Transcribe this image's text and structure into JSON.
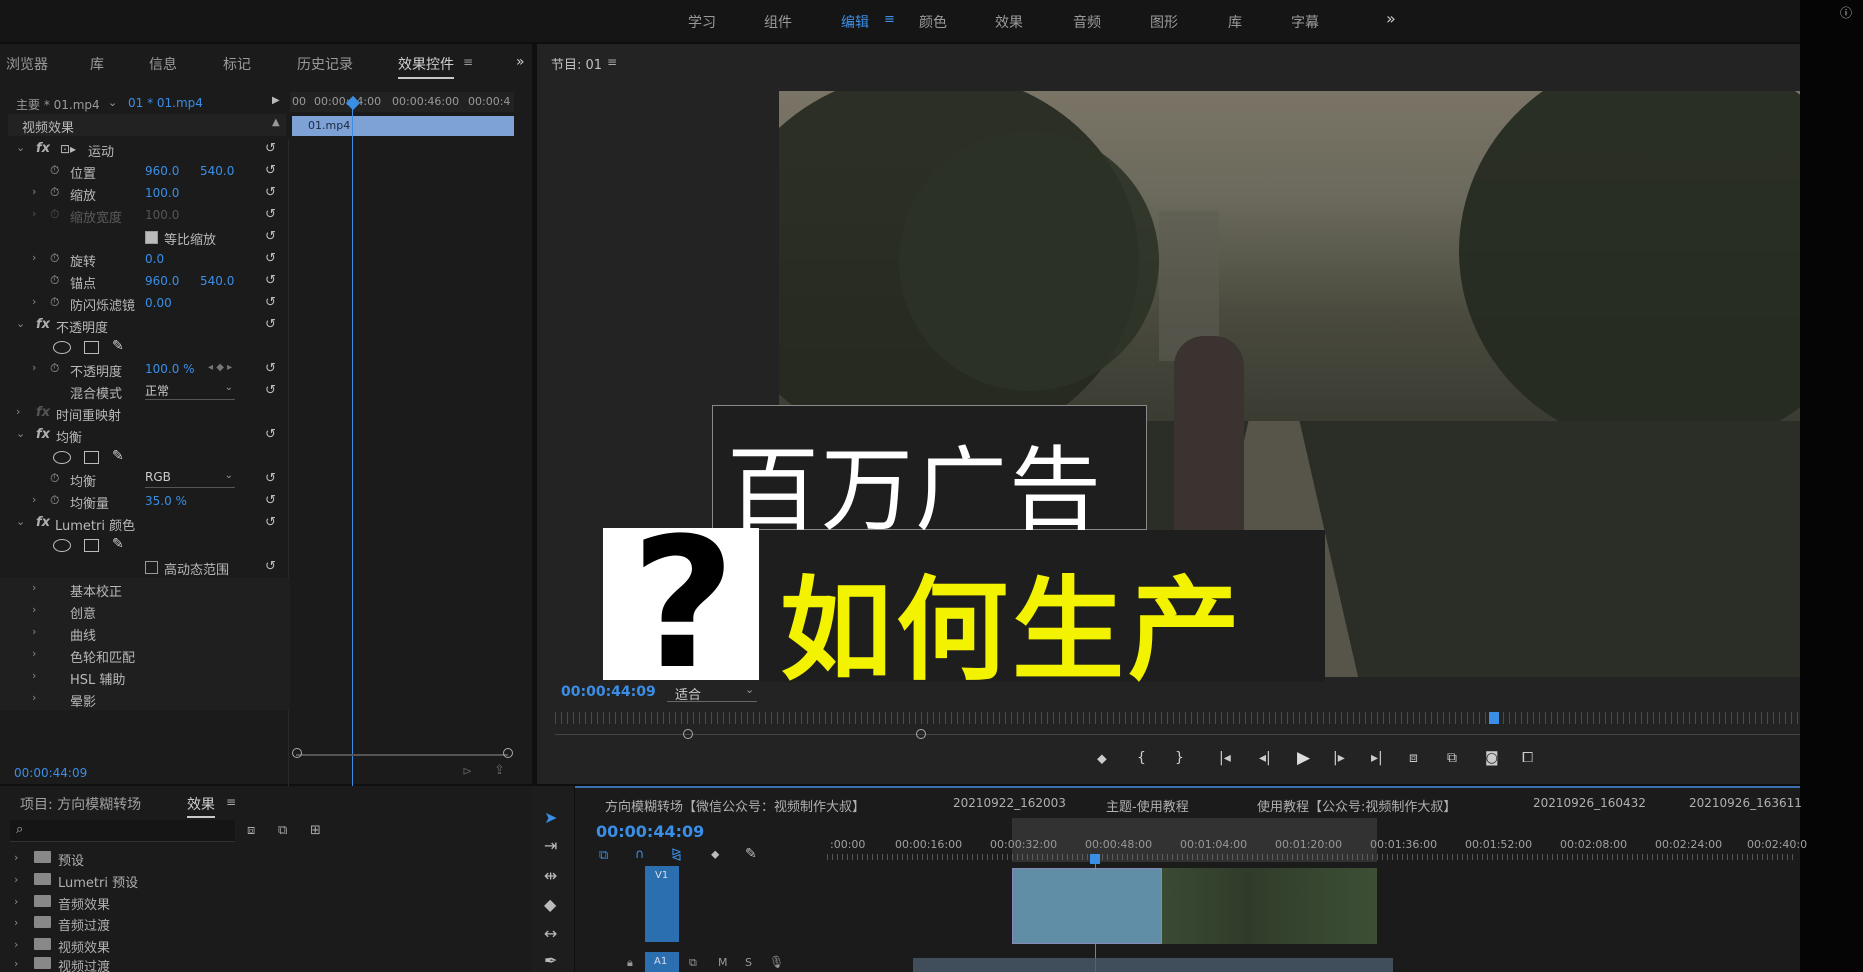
{
  "workspaces": [
    "学习",
    "组件",
    "编辑",
    "颜色",
    "效果",
    "音频",
    "图形",
    "库",
    "字幕"
  ],
  "workspace_active": "编辑",
  "workspace_more": "»",
  "left_tabs": [
    "浏览器",
    "库",
    "信息",
    "标记",
    "历史记录",
    "效果控件"
  ],
  "left_tabs_more": "»",
  "program_title": "节目: 01",
  "ec": {
    "master": "主要 * 01.mp4",
    "clip": "01 * 01.mp4",
    "ruler": [
      "00",
      "00:00:44:00",
      "00:00:46:00",
      "00:00:4"
    ],
    "clip_bar": "01.mp4",
    "section_video": "视频效果",
    "time": "00:00:44:09",
    "rows": {
      "motion": "运动",
      "position": "位置",
      "position_x": "960.0",
      "position_y": "540.0",
      "scale": "缩放",
      "scale_v": "100.0",
      "scale_w": "缩放宽度",
      "scale_w_v": "100.0",
      "uniform": "等比缩放",
      "rotation": "旋转",
      "rotation_v": "0.0",
      "anchor": "锚点",
      "anchor_x": "960.0",
      "anchor_y": "540.0",
      "flicker": "防闪烁滤镜",
      "flicker_v": "0.00",
      "opacity_group": "不透明度",
      "opacity": "不透明度",
      "opacity_v": "100.0 %",
      "blend": "混合模式",
      "blend_v": "正常",
      "timeremap": "时间重映射",
      "equalize_group": "均衡",
      "equalize": "均衡",
      "equalize_v": "RGB",
      "equalize_amt": "均衡量",
      "equalize_amt_v": "35.0 %",
      "lumetri": "Lumetri 颜色",
      "hdr": "高动态范围",
      "basic": "基本校正",
      "creative": "创意",
      "curves": "曲线",
      "wheels": "色轮和匹配",
      "hsl": "HSL 辅助",
      "vignette": "晕影"
    }
  },
  "monitor": {
    "caption_top": "百万广告",
    "caption_bottom": "如何生产",
    "question": "?",
    "timecode": "00:00:44:09",
    "fit": "适合"
  },
  "project": {
    "tab_project": "项目: 方向模糊转场",
    "tab_effects": "效果",
    "folders": [
      "预设",
      "Lumetri 预设",
      "音频效果",
      "音频过渡",
      "视频效果",
      "视频过渡"
    ]
  },
  "timeline": {
    "tabs": [
      "方向模糊转场【微信公众号：视频制作大叔】",
      "20210922_162003",
      "主题-使用教程",
      "使用教程【公众号:视频制作大叔】",
      "20210926_160432",
      "20210926_163611"
    ],
    "timecode": "00:00:44:09",
    "ruler": [
      ":00:00",
      "00:00:16:00",
      "00:00:32:00",
      "00:00:48:00",
      "00:01:04:00",
      "00:01:20:00",
      "00:01:36:00",
      "00:01:52:00",
      "00:02:08:00",
      "00:02:24:00",
      "00:02:40:0"
    ],
    "track_v": "V1",
    "track_a": "A1",
    "mute": "M",
    "solo": "S"
  }
}
